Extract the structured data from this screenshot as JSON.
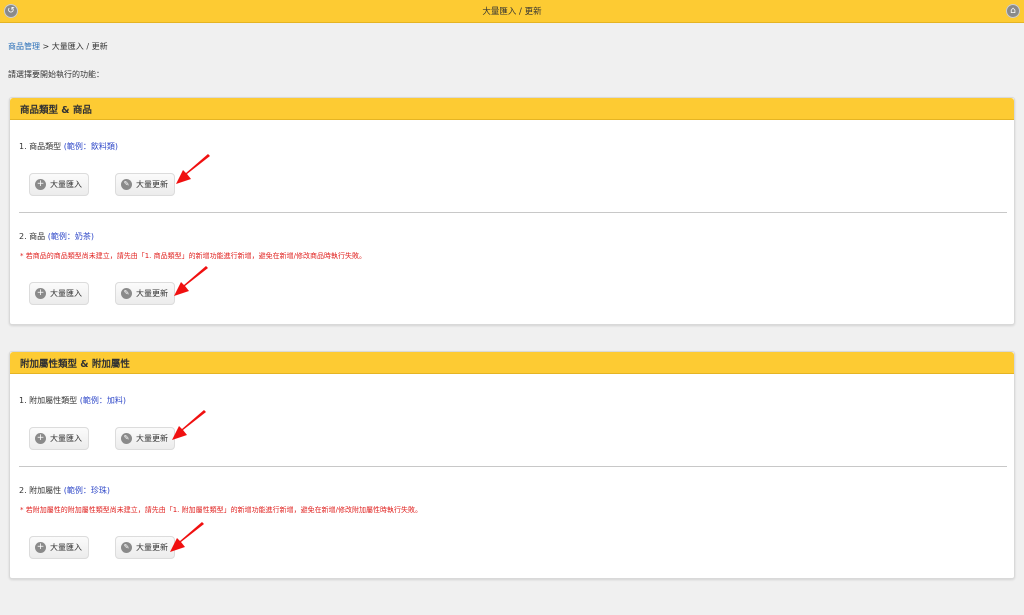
{
  "header": {
    "title": "大量匯入 / 更新"
  },
  "breadcrumb": {
    "link": "商品管理",
    "separator": " > ",
    "current": "大量匯入 / 更新"
  },
  "prompt": "請選擇要開始執行的功能：",
  "panels": [
    {
      "title": "商品類型 & 商品",
      "sections": [
        {
          "label": "1. 商品類型",
          "example": "(範例：飲料類)",
          "warning": "",
          "import_label": "大量匯入",
          "update_label": "大量更新"
        },
        {
          "label": "2. 商品",
          "example": "(範例：奶茶)",
          "warning": "* 若商品的商品類型尚未建立，請先由「1. 商品類型」的新增功能進行新增，避免在新增/修改商品時執行失敗。",
          "import_label": "大量匯入",
          "update_label": "大量更新"
        }
      ]
    },
    {
      "title": "附加屬性類型 & 附加屬性",
      "sections": [
        {
          "label": "1. 附加屬性類型",
          "example": "(範例：加料)",
          "warning": "",
          "import_label": "大量匯入",
          "update_label": "大量更新"
        },
        {
          "label": "2. 附加屬性",
          "example": "(範例：珍珠)",
          "warning": "* 若附加屬性的附加屬性類型尚未建立，請先由「1. 附加屬性類型」的新增功能進行新增，避免在新增/修改附加屬性時執行失敗。",
          "import_label": "大量匯入",
          "update_label": "大量更新"
        }
      ]
    }
  ],
  "icons": {
    "back": "back-arrow-icon",
    "home": "home-icon",
    "import": "plus-circle-icon",
    "update": "pencil-circle-icon"
  },
  "colors": {
    "header": "#fdcb33",
    "link": "#2a6fb8",
    "example": "#3049c9",
    "warning": "#e0201e",
    "annotation_arrow": "#f01010"
  }
}
